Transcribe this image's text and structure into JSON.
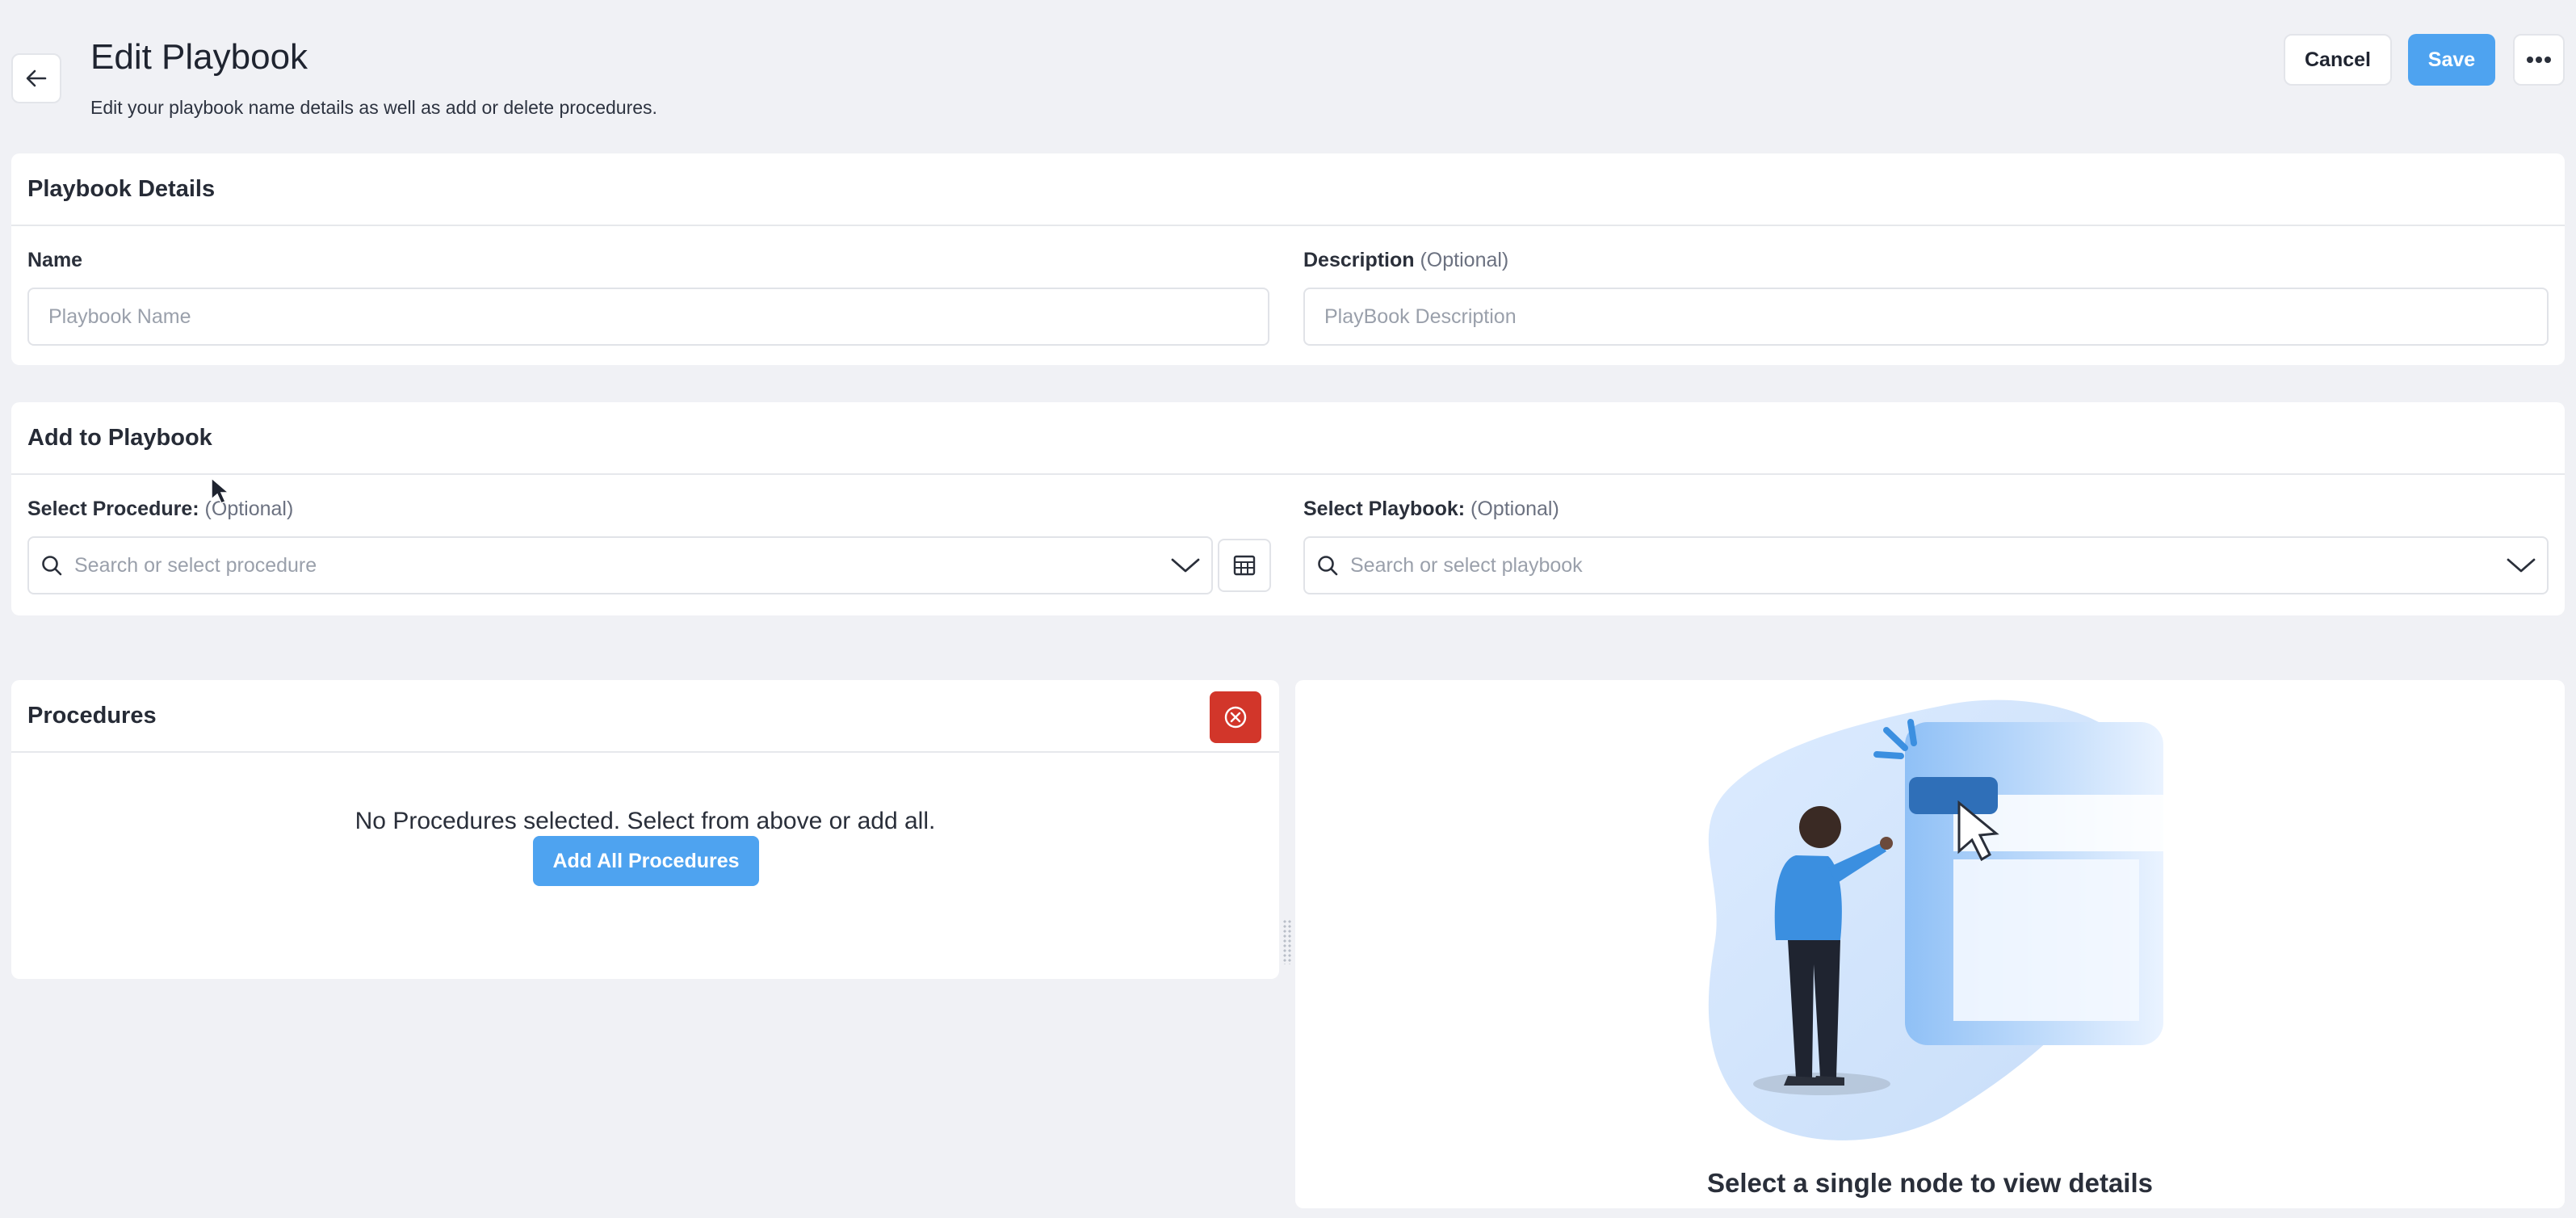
{
  "header": {
    "title": "Edit Playbook",
    "subtitle": "Edit your playbook name details as well as add or delete procedures.",
    "back_icon": "arrow-left-icon",
    "cancel_label": "Cancel",
    "save_label": "Save",
    "more_icon": "ellipsis-icon"
  },
  "details": {
    "title": "Playbook Details",
    "name_label": "Name",
    "name_placeholder": "Playbook Name",
    "description_label": "Description",
    "description_optional": "(Optional)",
    "description_placeholder": "PlayBook Description"
  },
  "add": {
    "title": "Add to Playbook",
    "procedure_label": "Select Procedure:",
    "procedure_optional": "(Optional)",
    "procedure_placeholder": "Search or select procedure",
    "playbook_label": "Select Playbook:",
    "playbook_optional": "(Optional)",
    "playbook_placeholder": "Search or select playbook"
  },
  "procedures": {
    "title": "Procedures",
    "empty_text": "No Procedures selected. Select from above or add all.",
    "add_all_label": "Add All Procedures"
  },
  "details_panel": {
    "caption": "Select a single node to view details"
  },
  "colors": {
    "primary": "#4ea3f0",
    "danger": "#d2362a",
    "background": "#f0f1f5"
  }
}
